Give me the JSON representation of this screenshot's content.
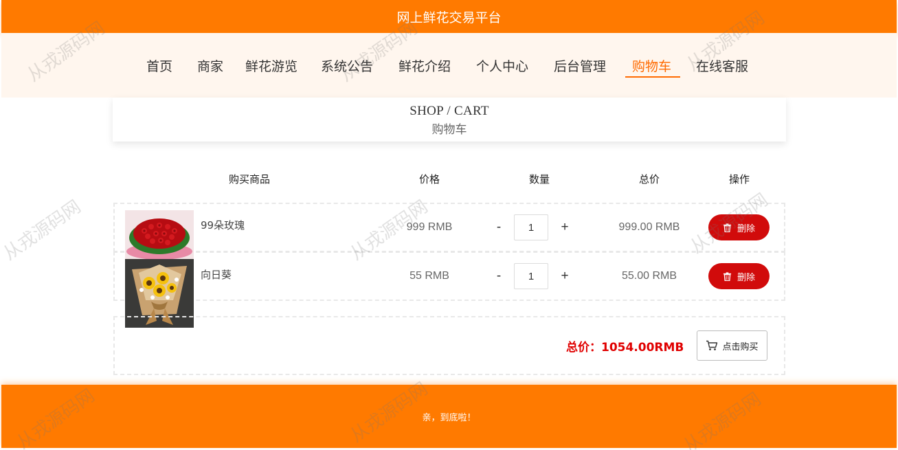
{
  "header": {
    "title": "网上鲜花交易平台"
  },
  "nav": {
    "items": [
      {
        "label": "首页"
      },
      {
        "label": "商家"
      },
      {
        "label": "鲜花游览"
      },
      {
        "label": "系统公告"
      },
      {
        "label": "鲜花介绍"
      },
      {
        "label": "个人中心"
      },
      {
        "label": "后台管理"
      },
      {
        "label": "购物车"
      },
      {
        "label": "在线客服"
      }
    ],
    "active_index": 7
  },
  "section": {
    "title_en": "SHOP / CART",
    "title_cn": "购物车"
  },
  "table": {
    "headers": [
      "购买商品",
      "价格",
      "数量",
      "总价",
      "操作"
    ],
    "rows": [
      {
        "name": "99朵玫瑰",
        "price": "999 RMB",
        "minus": "-",
        "qty": "1",
        "plus": "+",
        "total": "999.00 RMB",
        "delete_label": "删除"
      },
      {
        "name": "向日葵",
        "price": "55 RMB",
        "minus": "-",
        "qty": "1",
        "plus": "+",
        "total": "55.00 RMB",
        "delete_label": "删除"
      }
    ]
  },
  "summary": {
    "total_label": "总价：1054.00RMB",
    "buy_label": "点击购买"
  },
  "footer": {
    "text": "亲，到底啦！"
  },
  "watermark": {
    "text": "从戎源码网"
  },
  "colors": {
    "primary": "#ff7a00",
    "accent": "#ff6a00",
    "danger": "#d10b0b",
    "total": "#e00000"
  }
}
